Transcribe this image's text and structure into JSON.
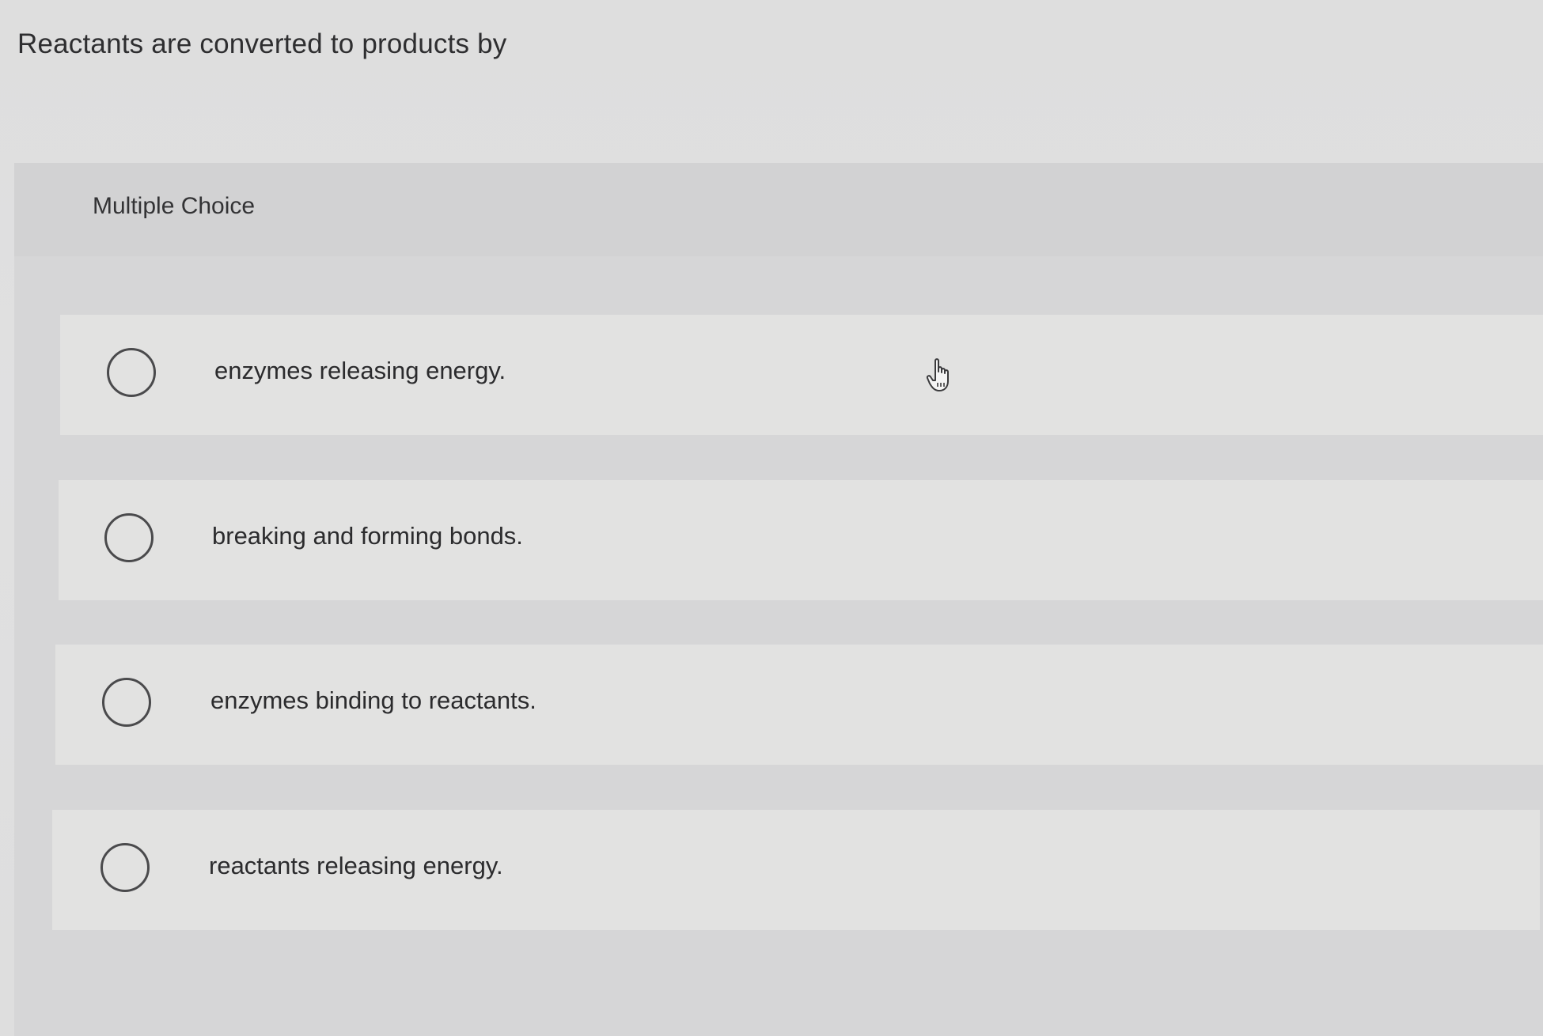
{
  "question": {
    "text": "Reactants are converted to products by"
  },
  "panel": {
    "type_label": "Multiple Choice"
  },
  "options": [
    {
      "label": "enzymes releasing energy.",
      "selected": false
    },
    {
      "label": "breaking and forming bonds.",
      "selected": false
    },
    {
      "label": "enzymes binding to reactants.",
      "selected": false
    },
    {
      "label": "reactants releasing energy.",
      "selected": false
    }
  ],
  "icons": {
    "radio": "radio-unselected-icon",
    "cursor": "hand-pointer-icon"
  }
}
